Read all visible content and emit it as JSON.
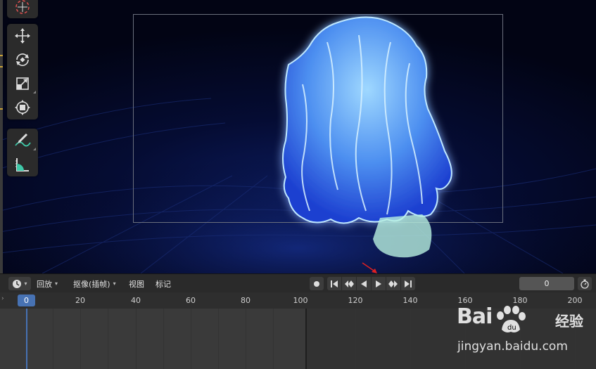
{
  "timeline": {
    "menus": [
      {
        "label": "回放",
        "has_dropdown": true
      },
      {
        "label": "抠像(插帧)",
        "has_dropdown": true
      },
      {
        "label": "视图",
        "has_dropdown": false
      },
      {
        "label": "标记",
        "has_dropdown": false
      }
    ],
    "current_frame": "0",
    "ruler_current": "0",
    "ruler_ticks": [
      "20",
      "40",
      "60",
      "80",
      "100",
      "120",
      "140",
      "160",
      "180",
      "200"
    ]
  },
  "toolbar": {
    "tools": [
      "cursor-tool",
      "move-tool",
      "rotate-tool",
      "scale-tool",
      "transform-tool",
      "annotate-tool",
      "measure-tool"
    ]
  },
  "playback_controls": [
    "record-button",
    "jump-to-start-button",
    "jump-to-previous-keyframe-button",
    "play-reverse-button",
    "play-button",
    "jump-to-next-keyframe-button",
    "jump-to-end-button"
  ],
  "watermark": {
    "brand_latin": "Bai",
    "brand_cn": "经验",
    "url": "jingyan.baidu.com"
  },
  "colors": {
    "accent_blue": "#4772b3",
    "cloth_glow": "#7fc8ff",
    "panel_bg": "#2a2a2a"
  }
}
